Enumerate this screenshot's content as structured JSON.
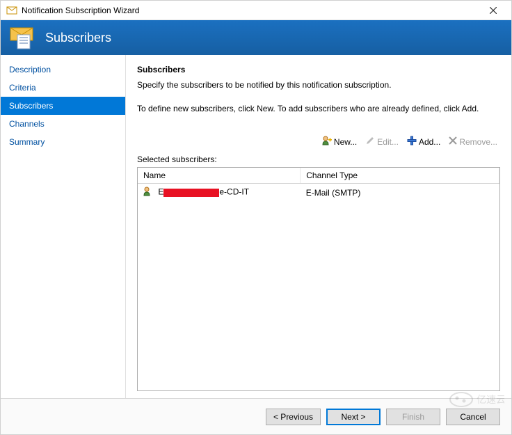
{
  "window": {
    "title": "Notification Subscription Wizard"
  },
  "banner": {
    "title": "Subscribers"
  },
  "nav": {
    "items": [
      {
        "label": "Description",
        "selected": false
      },
      {
        "label": "Criteria",
        "selected": false
      },
      {
        "label": "Subscribers",
        "selected": true
      },
      {
        "label": "Channels",
        "selected": false
      },
      {
        "label": "Summary",
        "selected": false
      }
    ]
  },
  "main": {
    "heading": "Subscribers",
    "description": "Specify the subscribers to be notified by this notification subscription.",
    "hint": "To define new subscribers, click New.  To add subscribers who are already defined, click Add.",
    "toolbar": {
      "new_label": "New...",
      "edit_label": "Edit...",
      "add_label": "Add...",
      "remove_label": "Remove..."
    },
    "list_label": "Selected subscribers:",
    "table": {
      "columns": [
        "Name",
        "Channel Type"
      ],
      "rows": [
        {
          "name_prefix": "E",
          "name_suffix": "e-CD-IT",
          "channel": "E-Mail (SMTP)"
        }
      ]
    }
  },
  "footer": {
    "previous": "< Previous",
    "next": "Next >",
    "finish": "Finish",
    "cancel": "Cancel"
  },
  "watermark": "亿速云"
}
